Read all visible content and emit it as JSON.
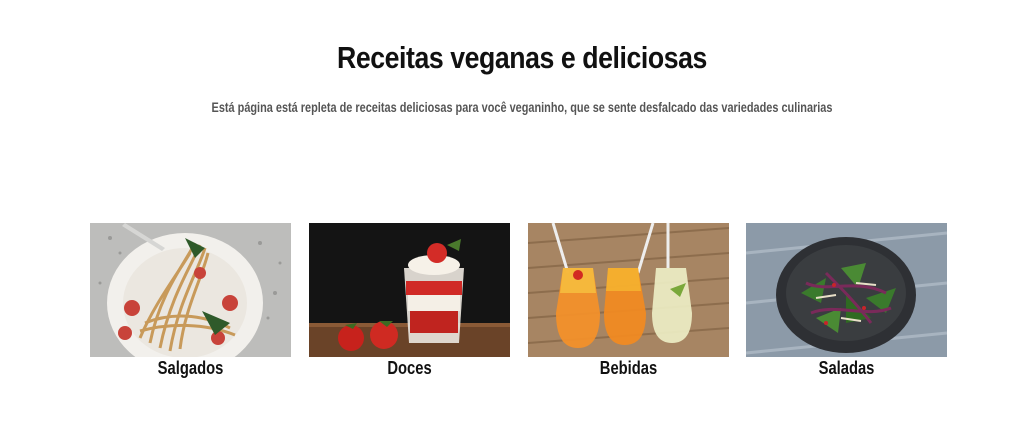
{
  "header": {
    "title": "Receitas veganas e deliciosas",
    "subtitle": "Está página está repleta de receitas deliciosas para você veganinho, que se sente desfalcado das variedades culinarias"
  },
  "categories": [
    {
      "label": "Salgados",
      "image": "pasta-dish-image"
    },
    {
      "label": "Doces",
      "image": "strawberry-dessert-image"
    },
    {
      "label": "Bebidas",
      "image": "juice-drinks-image"
    },
    {
      "label": "Saladas",
      "image": "salad-bowl-image"
    }
  ]
}
